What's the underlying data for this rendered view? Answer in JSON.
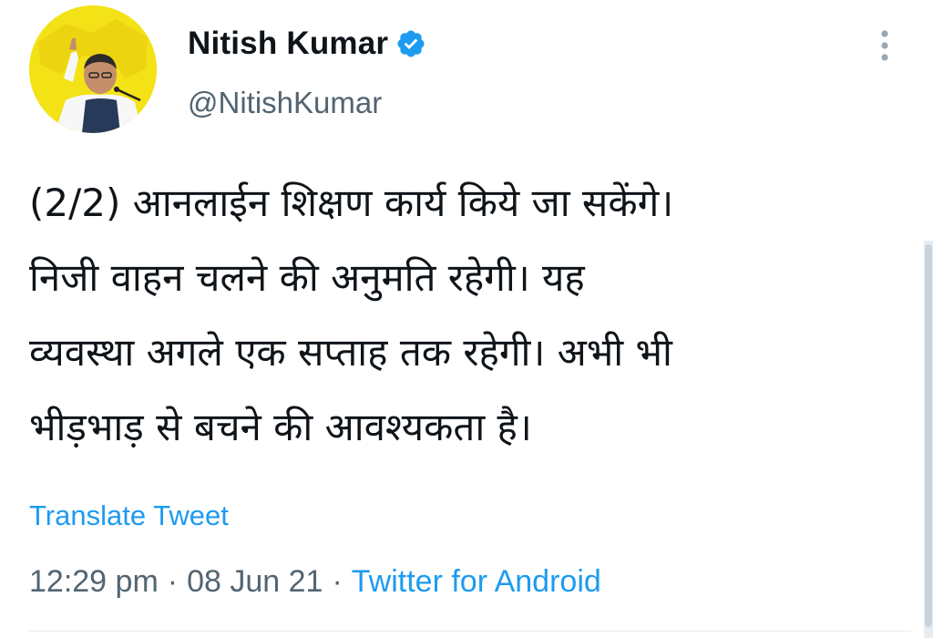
{
  "tweet": {
    "author": {
      "display_name": "Nitish Kumar",
      "handle": "@NitishKumar",
      "verified": true,
      "avatar_icon": "profile-photo",
      "avatar_bg": "#f3e216"
    },
    "text_lines": [
      "(2/2) आनलाईन शिक्षण कार्य किये जा सकेंगे।",
      "निजी वाहन चलने की अनुमति रहेगी। यह",
      "व्यवस्था अगले एक सप्ताह तक रहेगी। अभी भी",
      "भीड़भाड़ से बचने की आवश्यकता है।"
    ],
    "translate_label": "Translate Tweet",
    "meta": {
      "time": "12:29 pm",
      "separator": "·",
      "date": "08 Jun 21",
      "source": "Twitter for Android"
    }
  },
  "icons": {
    "verified": "verified-badge-icon",
    "more": "more-vertical-icon"
  },
  "colors": {
    "accent": "#1d9bf0",
    "text_primary": "#0f1419",
    "text_secondary": "#536471",
    "divider": "#e6ecf0"
  }
}
